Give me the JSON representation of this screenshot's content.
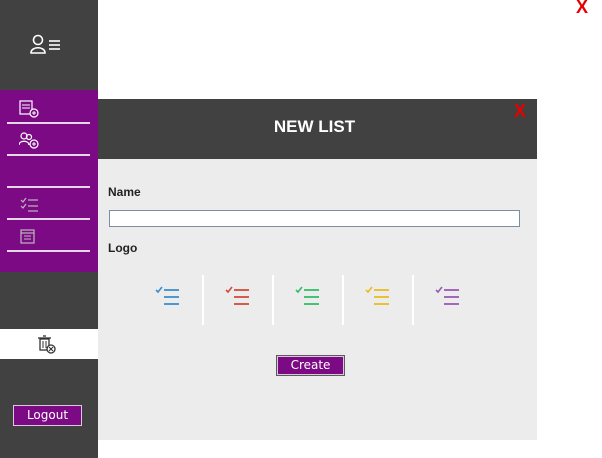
{
  "sidebar": {
    "top_icon": "user-list-icon",
    "items": [
      {
        "icon": "new-list-icon"
      },
      {
        "icon": "add-user-icon"
      },
      {
        "icon": "blank"
      },
      {
        "icon": "checklist-icon"
      },
      {
        "icon": "calendar-icon"
      }
    ],
    "selected_icon": "delete-list-icon",
    "logout_label": "Logout"
  },
  "window": {
    "close_label": "X"
  },
  "dialog": {
    "title": "NEW LIST",
    "close_label": "X",
    "name_label": "Name",
    "name_value": "",
    "logo_label": "Logo",
    "logos": [
      {
        "icon": "checklist-icon-blue",
        "color": "#3d8fcf"
      },
      {
        "icon": "checklist-icon-red",
        "color": "#d24c3a"
      },
      {
        "icon": "checklist-icon-green",
        "color": "#2fbf6a"
      },
      {
        "icon": "checklist-icon-yellow",
        "color": "#e8bd1c"
      },
      {
        "icon": "checklist-icon-purple",
        "color": "#9b59b6"
      }
    ],
    "create_label": "Create"
  },
  "colors": {
    "accent": "#7d0a85",
    "dark": "#414141",
    "close": "#e60000",
    "panel": "#ececec"
  }
}
